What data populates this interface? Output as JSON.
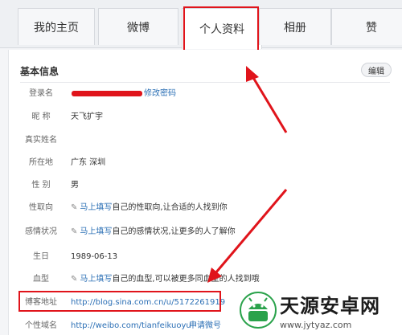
{
  "tabs": [
    {
      "label": "我的主页"
    },
    {
      "label": "微博"
    },
    {
      "label": "个人资料"
    },
    {
      "label": "相册"
    },
    {
      "label": "赞"
    }
  ],
  "section": {
    "title": "基本信息",
    "edit_label": "编辑"
  },
  "rows": {
    "login": {
      "label": "登录名",
      "change_password": "修改密码"
    },
    "nickname": {
      "label": "昵 称",
      "value": "天飞扩宇"
    },
    "realname": {
      "label": "真实姓名",
      "value": ""
    },
    "location": {
      "label": "所在地",
      "value": "广东 深圳"
    },
    "gender": {
      "label": "性 别",
      "value": "男"
    },
    "orientation": {
      "label": "性取向",
      "link": "马上填写",
      "text": "自己的性取向,让合适的人找到你"
    },
    "relationship": {
      "label": "感情状况",
      "link": "马上填写",
      "text": "自己的感情状况,让更多的人了解你"
    },
    "birthday": {
      "label": "生日",
      "value": "1989-06-13"
    },
    "blood": {
      "label": "血型",
      "link": "马上填写",
      "text": "自己的血型,可以被更多同血型的人找到哦"
    },
    "blog": {
      "label": "博客地址",
      "value": "http://blog.sina.com.cn/u/5172261919"
    },
    "domain": {
      "label": "个性域名",
      "value": "http://weibo.com/tianfeikuoyu",
      "apply": "申请微号"
    }
  },
  "watermark": {
    "title": "天源安卓网",
    "url": "www.jytyaz.com"
  },
  "colors": {
    "highlight": "#e0141b",
    "link": "#2b6fb5"
  }
}
